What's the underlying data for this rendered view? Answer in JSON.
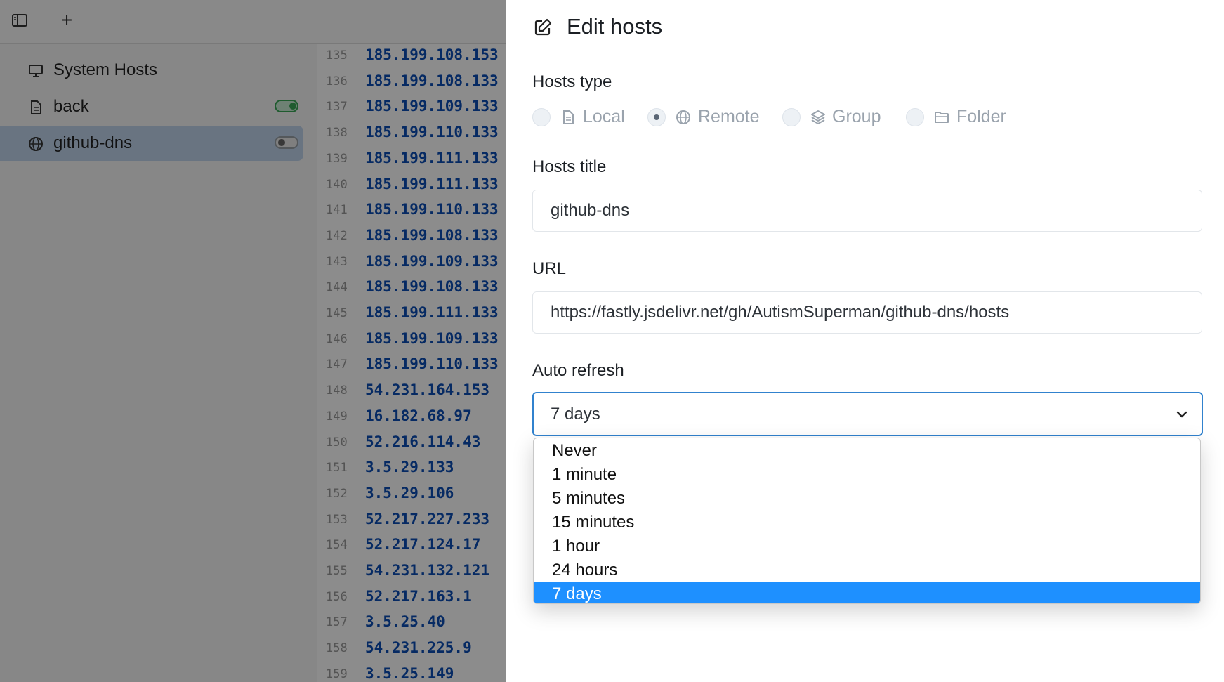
{
  "topbar": {
    "sidebar_toggle_icon": "sidebar-layout-icon",
    "add_icon": "plus-icon",
    "add_label": "+"
  },
  "sidebar": {
    "items": [
      {
        "label": "System Hosts",
        "icon": "monitor-icon"
      },
      {
        "label": "back",
        "icon": "file-icon",
        "toggle": "on"
      },
      {
        "label": "github-dns",
        "icon": "globe-icon",
        "toggle": "off",
        "active": true
      }
    ]
  },
  "editor": {
    "lines": [
      {
        "n": "135",
        "text": "185.199.108.153"
      },
      {
        "n": "136",
        "text": "185.199.108.133"
      },
      {
        "n": "137",
        "text": "185.199.109.133"
      },
      {
        "n": "138",
        "text": "185.199.110.133"
      },
      {
        "n": "139",
        "text": "185.199.111.133"
      },
      {
        "n": "140",
        "text": "185.199.111.133"
      },
      {
        "n": "141",
        "text": "185.199.110.133"
      },
      {
        "n": "142",
        "text": "185.199.108.133"
      },
      {
        "n": "143",
        "text": "185.199.109.133"
      },
      {
        "n": "144",
        "text": "185.199.108.133"
      },
      {
        "n": "145",
        "text": "185.199.111.133"
      },
      {
        "n": "146",
        "text": "185.199.109.133"
      },
      {
        "n": "147",
        "text": "185.199.110.133"
      },
      {
        "n": "148",
        "text": "54.231.164.153"
      },
      {
        "n": "149",
        "text": "16.182.68.97"
      },
      {
        "n": "150",
        "text": "52.216.114.43"
      },
      {
        "n": "151",
        "text": "3.5.29.133"
      },
      {
        "n": "152",
        "text": "3.5.29.106"
      },
      {
        "n": "153",
        "text": "52.217.227.233"
      },
      {
        "n": "154",
        "text": "52.217.124.17"
      },
      {
        "n": "155",
        "text": "54.231.132.121"
      },
      {
        "n": "156",
        "text": "52.217.163.1"
      },
      {
        "n": "157",
        "text": "3.5.25.40"
      },
      {
        "n": "158",
        "text": "54.231.225.9"
      },
      {
        "n": "159",
        "text": "3.5.25.149"
      }
    ]
  },
  "drawer": {
    "title": "Edit hosts",
    "hosts_type": {
      "label": "Hosts type",
      "options": [
        {
          "label": "Local",
          "icon": "file-icon",
          "checked": false
        },
        {
          "label": "Remote",
          "icon": "globe-icon",
          "checked": true
        },
        {
          "label": "Group",
          "icon": "layers-icon",
          "checked": false
        },
        {
          "label": "Folder",
          "icon": "folder-icon",
          "checked": false
        }
      ]
    },
    "hosts_title": {
      "label": "Hosts title",
      "value": "github-dns"
    },
    "url": {
      "label": "URL",
      "value": "https://fastly.jsdelivr.net/gh/AutismSuperman/github-dns/hosts"
    },
    "auto_refresh": {
      "label": "Auto refresh",
      "value": "7 days",
      "options": [
        "Never",
        "1 minute",
        "5 minutes",
        "15 minutes",
        "1 hour",
        "24 hours",
        "7 days"
      ],
      "selected_index": 6
    }
  },
  "colors": {
    "accent": "#3182ce",
    "selected_option": "#1e90ff",
    "code": "#0b4db5",
    "toggle_on": "#3aa757"
  }
}
